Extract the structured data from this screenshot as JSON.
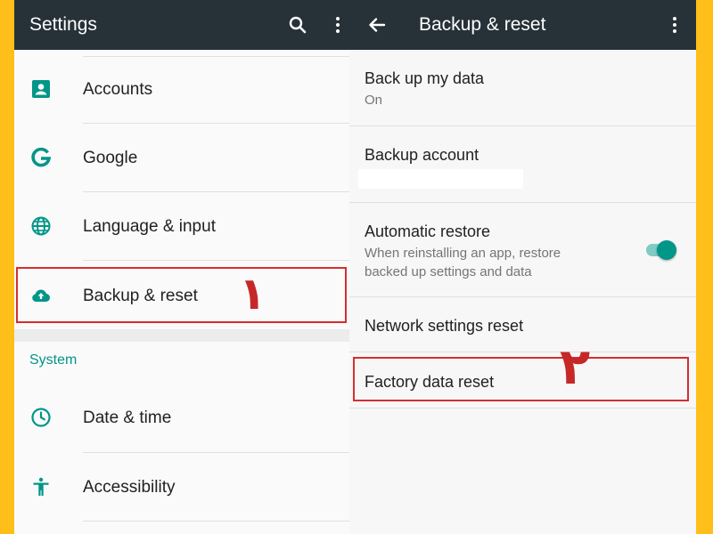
{
  "left": {
    "appbar": {
      "title": "Settings",
      "icons": [
        "search-icon",
        "more-vert-icon"
      ]
    },
    "items": [
      {
        "label": "Accounts",
        "icon": "account-box-icon"
      },
      {
        "label": "Google",
        "icon": "google-icon"
      },
      {
        "label": "Language & input",
        "icon": "globe-icon"
      },
      {
        "label": "Backup & reset",
        "icon": "cloud-upload-icon"
      }
    ],
    "section_header": "System",
    "system_items": [
      {
        "label": "Date & time",
        "icon": "clock-icon"
      },
      {
        "label": "Accessibility",
        "icon": "accessibility-icon"
      }
    ],
    "annotation": "١"
  },
  "right": {
    "appbar": {
      "title": "Backup & reset",
      "icons": [
        "back-arrow-icon",
        "more-vert-icon"
      ]
    },
    "prefs": [
      {
        "title": "Back up my data",
        "summary": "On"
      },
      {
        "title": "Backup account",
        "summary": ""
      },
      {
        "title": "Automatic restore",
        "summary_line1": "When reinstalling an app, restore",
        "summary_line2": "backed up settings and data",
        "toggle": true
      },
      {
        "title": "Network settings reset"
      },
      {
        "title": "Factory data reset"
      }
    ],
    "annotation": "٢"
  },
  "colors": {
    "appbar": "#263238",
    "accent": "#009688",
    "highlight": "#d32f2f",
    "frame": "#ffbf1a"
  }
}
